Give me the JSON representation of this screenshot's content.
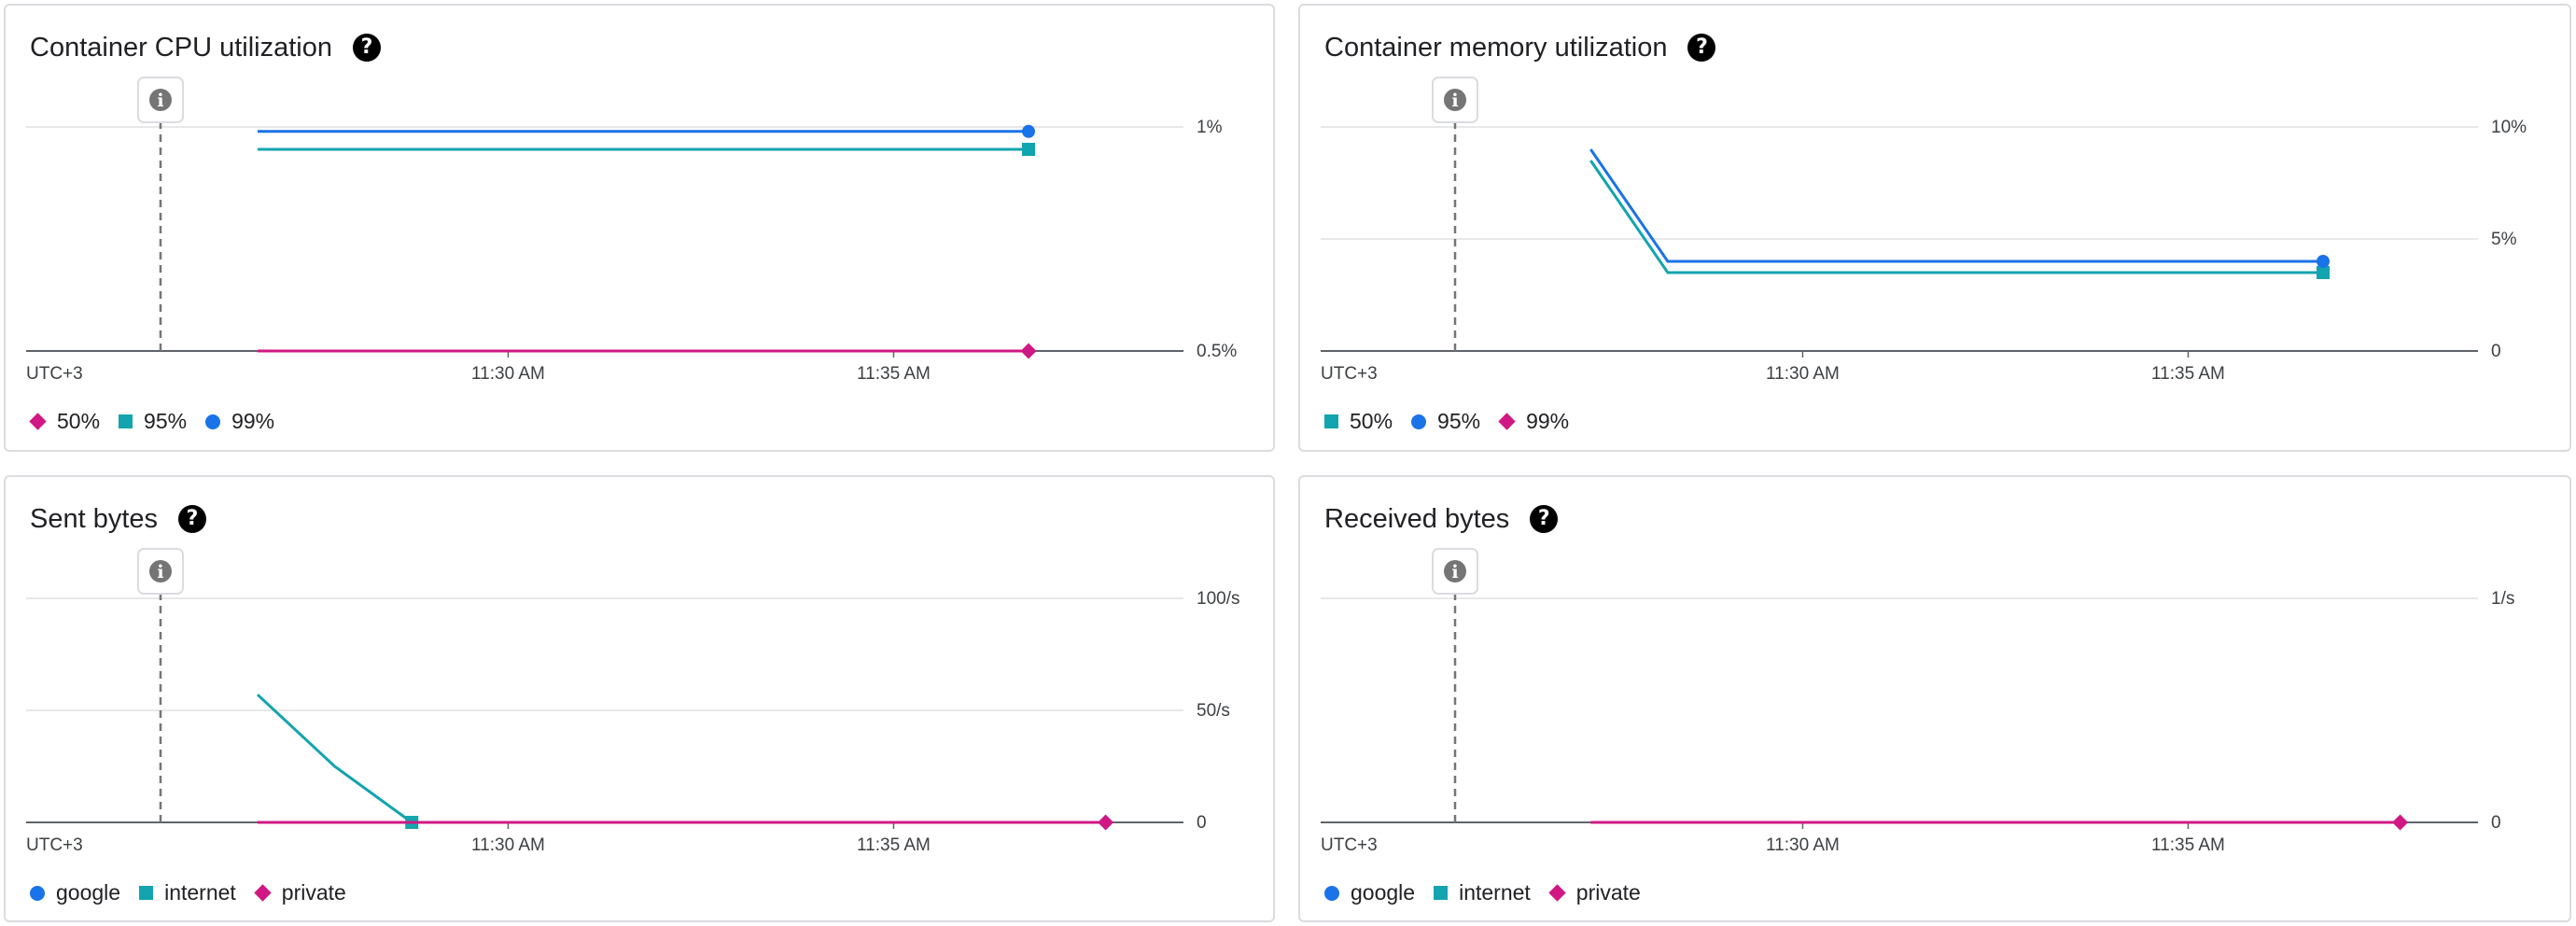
{
  "colors": {
    "blue": "#1a73e8",
    "teal": "#12a4af",
    "magenta": "#d01884"
  },
  "chart_data": [
    {
      "type": "line",
      "title": "Container CPU utilization",
      "x_timezone": "UTC+3",
      "x_ticks": [
        "11:30 AM",
        "11:35 AM"
      ],
      "y_ticks": [
        "1%",
        "0.5%"
      ],
      "ylim": [
        0.5,
        1.0
      ],
      "series": [
        {
          "name": "50%",
          "marker": "diamond",
          "color": "#d01884",
          "x": [
            "11:26:45",
            "11:36:45"
          ],
          "y": [
            0.5,
            0.5
          ]
        },
        {
          "name": "95%",
          "marker": "square",
          "color": "#12a4af",
          "x": [
            "11:26:45",
            "11:36:45"
          ],
          "y": [
            0.95,
            0.95
          ]
        },
        {
          "name": "99%",
          "marker": "circle",
          "color": "#1a73e8",
          "x": [
            "11:26:45",
            "11:36:45"
          ],
          "y": [
            0.99,
            0.99
          ]
        }
      ]
    },
    {
      "type": "line",
      "title": "Container memory utilization",
      "x_timezone": "UTC+3",
      "x_ticks": [
        "11:30 AM",
        "11:35 AM"
      ],
      "y_ticks": [
        "10%",
        "5%",
        "0"
      ],
      "ylim": [
        0,
        10
      ],
      "series": [
        {
          "name": "50%",
          "marker": "square",
          "color": "#12a4af",
          "x": [
            "11:27:15",
            "11:28:15",
            "11:36:45"
          ],
          "y": [
            8.5,
            3.5,
            3.5
          ]
        },
        {
          "name": "95%",
          "marker": "circle",
          "color": "#1a73e8",
          "x": [
            "11:27:15",
            "11:28:15",
            "11:36:45"
          ],
          "y": [
            9.0,
            4.0,
            4.0
          ]
        },
        {
          "name": "99%",
          "marker": "diamond",
          "color": "#d01884",
          "x": [],
          "y": []
        }
      ]
    },
    {
      "type": "line",
      "title": "Sent bytes",
      "x_timezone": "UTC+3",
      "x_ticks": [
        "11:30 AM",
        "11:35 AM"
      ],
      "y_ticks": [
        "100/s",
        "50/s",
        "0"
      ],
      "ylim": [
        0,
        100
      ],
      "series": [
        {
          "name": "google",
          "marker": "circle",
          "color": "#1a73e8",
          "x": [],
          "y": []
        },
        {
          "name": "internet",
          "marker": "square",
          "color": "#12a4af",
          "x": [
            "11:26:45",
            "11:27:45",
            "11:28:45"
          ],
          "y": [
            57,
            25,
            0
          ]
        },
        {
          "name": "private",
          "marker": "diamond",
          "color": "#d01884",
          "x": [
            "11:26:45",
            "11:37:45"
          ],
          "y": [
            0,
            0
          ]
        }
      ]
    },
    {
      "type": "line",
      "title": "Received bytes",
      "x_timezone": "UTC+3",
      "x_ticks": [
        "11:30 AM",
        "11:35 AM"
      ],
      "y_ticks": [
        "1/s",
        "0"
      ],
      "ylim": [
        0,
        1
      ],
      "series": [
        {
          "name": "google",
          "marker": "circle",
          "color": "#1a73e8",
          "x": [],
          "y": []
        },
        {
          "name": "internet",
          "marker": "square",
          "color": "#12a4af",
          "x": [],
          "y": []
        },
        {
          "name": "private",
          "marker": "diamond",
          "color": "#d01884",
          "x": [
            "11:27:15",
            "11:37:45"
          ],
          "y": [
            0,
            0
          ]
        }
      ]
    }
  ],
  "help_glyph": "?",
  "info_glyph": "i"
}
